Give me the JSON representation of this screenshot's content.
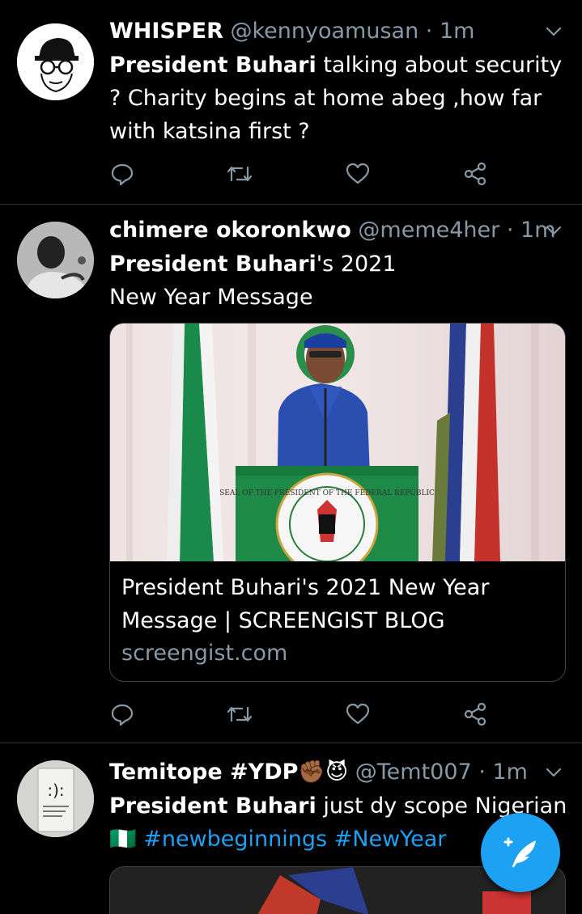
{
  "tweets": [
    {
      "name": "WHISPER",
      "handle": "@kennyoamusan",
      "separator": "·",
      "time": "1m",
      "text_bold": "President Buhari",
      "text_rest": "  talking about security ? Charity begins at home abeg ,how far with katsina first  ?"
    },
    {
      "name": "chimere okoronkwo",
      "handle": "@meme4her",
      "separator": "·",
      "time": "1m",
      "text_bold": "President Buhari",
      "text_rest": "'s 2021 New Year Message",
      "card": {
        "title": "President Buhari's 2021 New Year Message | SCREENGIST BLOG",
        "domain": "screengist.com",
        "seal_text": "SEAL OF THE PRESIDENT OF THE FEDERAL REPUBLIC"
      }
    },
    {
      "name": "Temitope #YDP",
      "name_emoji": "✊🏾😈",
      "handle": "@Temt007",
      "separator": "·",
      "time": "1m",
      "text_bold": "President Buhari",
      "text_rest": " just dy scope Nigerians",
      "flag_emoji": "🇳🇬",
      "hashtags": "#newbeginnings #NewYear"
    }
  ],
  "icons": {
    "reply": "reply-icon",
    "retweet": "retweet-icon",
    "like": "like-icon",
    "share": "share-icon",
    "chevron": "chevron-down-icon",
    "compose": "compose-tweet-icon"
  },
  "colors": {
    "background": "#000000",
    "accent": "#1da1f2",
    "secondary_text": "#8899a6",
    "divider": "#2f3336"
  }
}
